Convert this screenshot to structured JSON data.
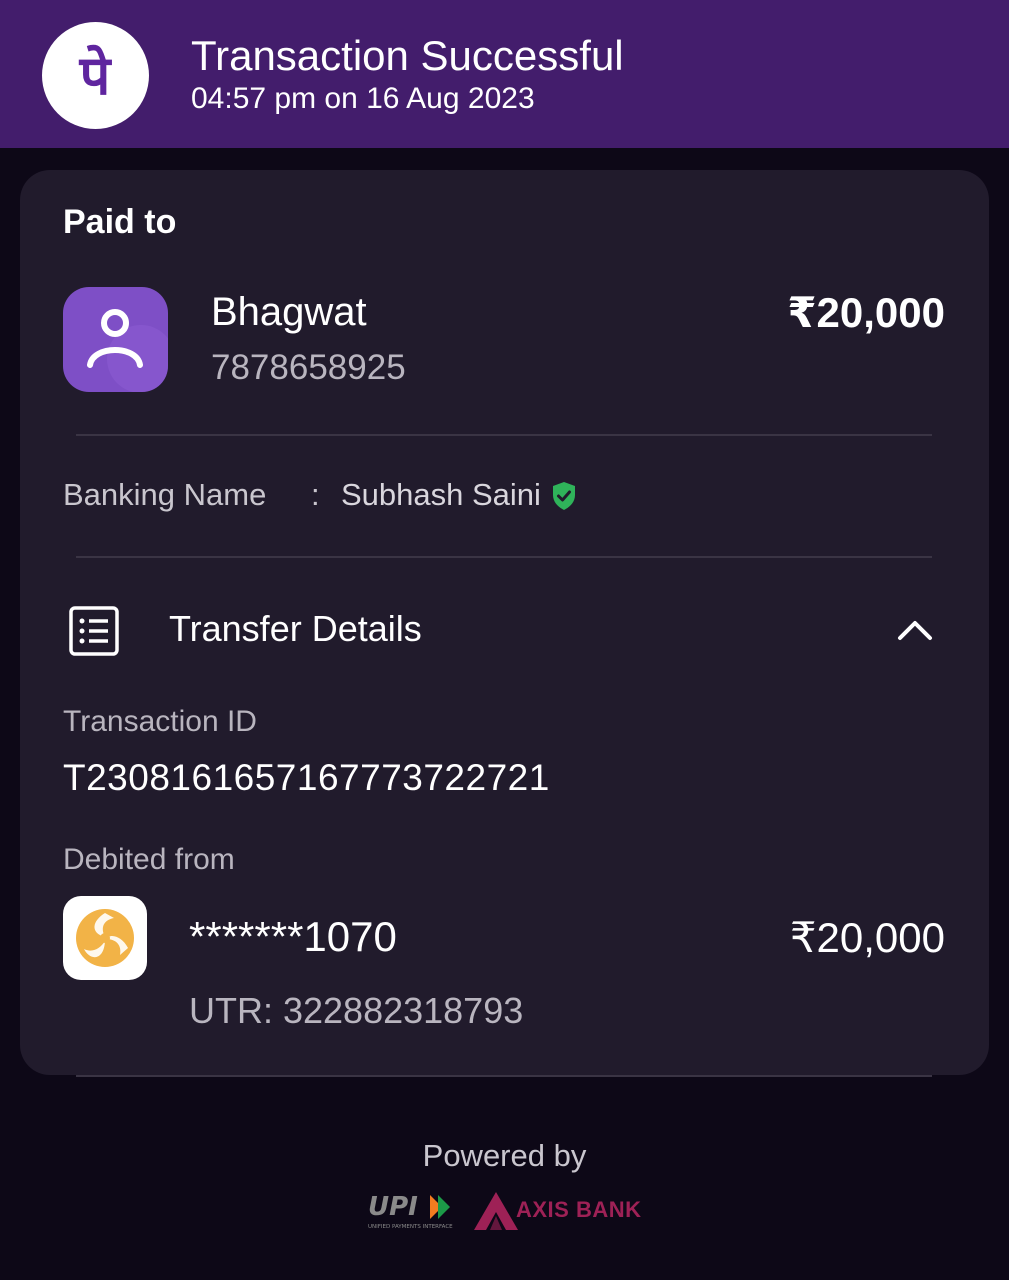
{
  "header": {
    "logo_glyph": "पे",
    "title": "Transaction Successful",
    "subtitle": "04:57 pm on 16 Aug 2023",
    "background": "#431d6c"
  },
  "payee": {
    "section_label": "Paid to",
    "name": "Bhagwat",
    "phone": "7878658925",
    "amount": "₹20,000",
    "avatar_icon": "person-icon"
  },
  "banking": {
    "label": "Banking Name",
    "separator": ":",
    "value": "Subhash Saini",
    "verified_icon": "verified-shield-icon",
    "verified_color": "#2fb35a"
  },
  "transfer": {
    "title": "Transfer Details",
    "icon": "receipt-list-icon",
    "toggle_icon": "chevron-up-icon",
    "transaction_id_label": "Transaction ID",
    "transaction_id": "T2308161657167773722721",
    "debited_from_label": "Debited from",
    "account": "*******1070",
    "amount": "₹20,000",
    "utr": "UTR: 322882318793",
    "bank_icon": "icici-bank-logo"
  },
  "footer": {
    "powered_by": "Powered by",
    "upi_text": "UPI",
    "upi_subtext": "UNIFIED PAYMENTS INTERFACE",
    "bank_name": "AXIS BANK"
  }
}
